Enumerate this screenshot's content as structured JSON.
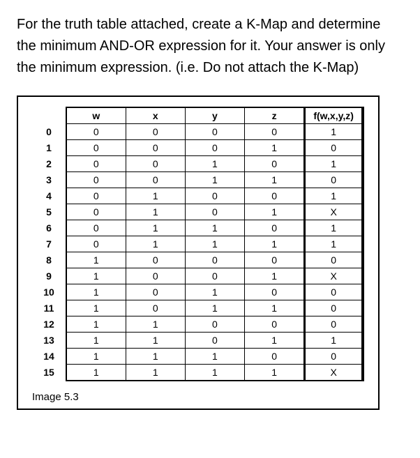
{
  "prompt": "For the truth table attached, create a K-Map and determine the minimum AND-OR expression for it. Your answer is only the minimum expression. (i.e. Do not attach the K-Map)",
  "caption": "Image 5.3",
  "table": {
    "headers": [
      "w",
      "x",
      "y",
      "z",
      "f(w,x,y,z)"
    ],
    "rows": [
      {
        "index": "0",
        "w": "0",
        "x": "0",
        "y": "0",
        "z": "0",
        "f": "1"
      },
      {
        "index": "1",
        "w": "0",
        "x": "0",
        "y": "0",
        "z": "1",
        "f": "0"
      },
      {
        "index": "2",
        "w": "0",
        "x": "0",
        "y": "1",
        "z": "0",
        "f": "1"
      },
      {
        "index": "3",
        "w": "0",
        "x": "0",
        "y": "1",
        "z": "1",
        "f": "0"
      },
      {
        "index": "4",
        "w": "0",
        "x": "1",
        "y": "0",
        "z": "0",
        "f": "1"
      },
      {
        "index": "5",
        "w": "0",
        "x": "1",
        "y": "0",
        "z": "1",
        "f": "X"
      },
      {
        "index": "6",
        "w": "0",
        "x": "1",
        "y": "1",
        "z": "0",
        "f": "1"
      },
      {
        "index": "7",
        "w": "0",
        "x": "1",
        "y": "1",
        "z": "1",
        "f": "1"
      },
      {
        "index": "8",
        "w": "1",
        "x": "0",
        "y": "0",
        "z": "0",
        "f": "0"
      },
      {
        "index": "9",
        "w": "1",
        "x": "0",
        "y": "0",
        "z": "1",
        "f": "X"
      },
      {
        "index": "10",
        "w": "1",
        "x": "0",
        "y": "1",
        "z": "0",
        "f": "0"
      },
      {
        "index": "11",
        "w": "1",
        "x": "0",
        "y": "1",
        "z": "1",
        "f": "0"
      },
      {
        "index": "12",
        "w": "1",
        "x": "1",
        "y": "0",
        "z": "0",
        "f": "0"
      },
      {
        "index": "13",
        "w": "1",
        "x": "1",
        "y": "0",
        "z": "1",
        "f": "1"
      },
      {
        "index": "14",
        "w": "1",
        "x": "1",
        "y": "1",
        "z": "0",
        "f": "0"
      },
      {
        "index": "15",
        "w": "1",
        "x": "1",
        "y": "1",
        "z": "1",
        "f": "X"
      }
    ]
  }
}
